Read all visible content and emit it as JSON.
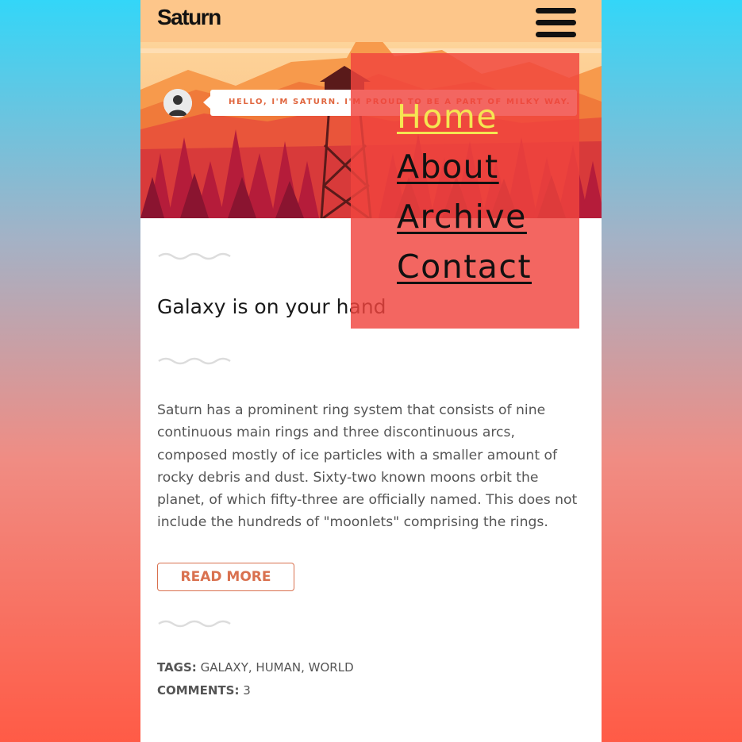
{
  "header": {
    "brand": "Saturn",
    "menu_icon": "hamburger-menu-icon"
  },
  "hero": {
    "greeting": "HELLO, I'M SATURN. I'M PROUD TO BE A PART OF MILKY WAY.",
    "colors": {
      "sky": "#fdc68a",
      "mountains": "#f0763f",
      "forest": "#c8203c"
    }
  },
  "nav_menu": {
    "items": [
      {
        "label": "Home",
        "active": true
      },
      {
        "label": "About",
        "active": false
      },
      {
        "label": "Archive",
        "active": false
      },
      {
        "label": "Contact",
        "active": false
      }
    ],
    "active_color": "#f5e652",
    "overlay_color": "#f0443e"
  },
  "post": {
    "title": "Galaxy is on your hand",
    "excerpt": "Saturn has a prominent ring system that consists of nine continuous main rings and three discontinuous arcs, composed mostly of ice particles with a smaller amount of rocky debris and dust. Sixty-two known moons orbit the planet, of which fifty-three are officially named. This does not include the hundreds of \"moonlets\" comprising the rings.",
    "read_more_label": "READ MORE",
    "tags_label": "TAGS:",
    "tags": [
      "GALAXY",
      "HUMAN",
      "WORLD"
    ],
    "comments_label": "COMMENTS:",
    "comments_count": "3"
  }
}
